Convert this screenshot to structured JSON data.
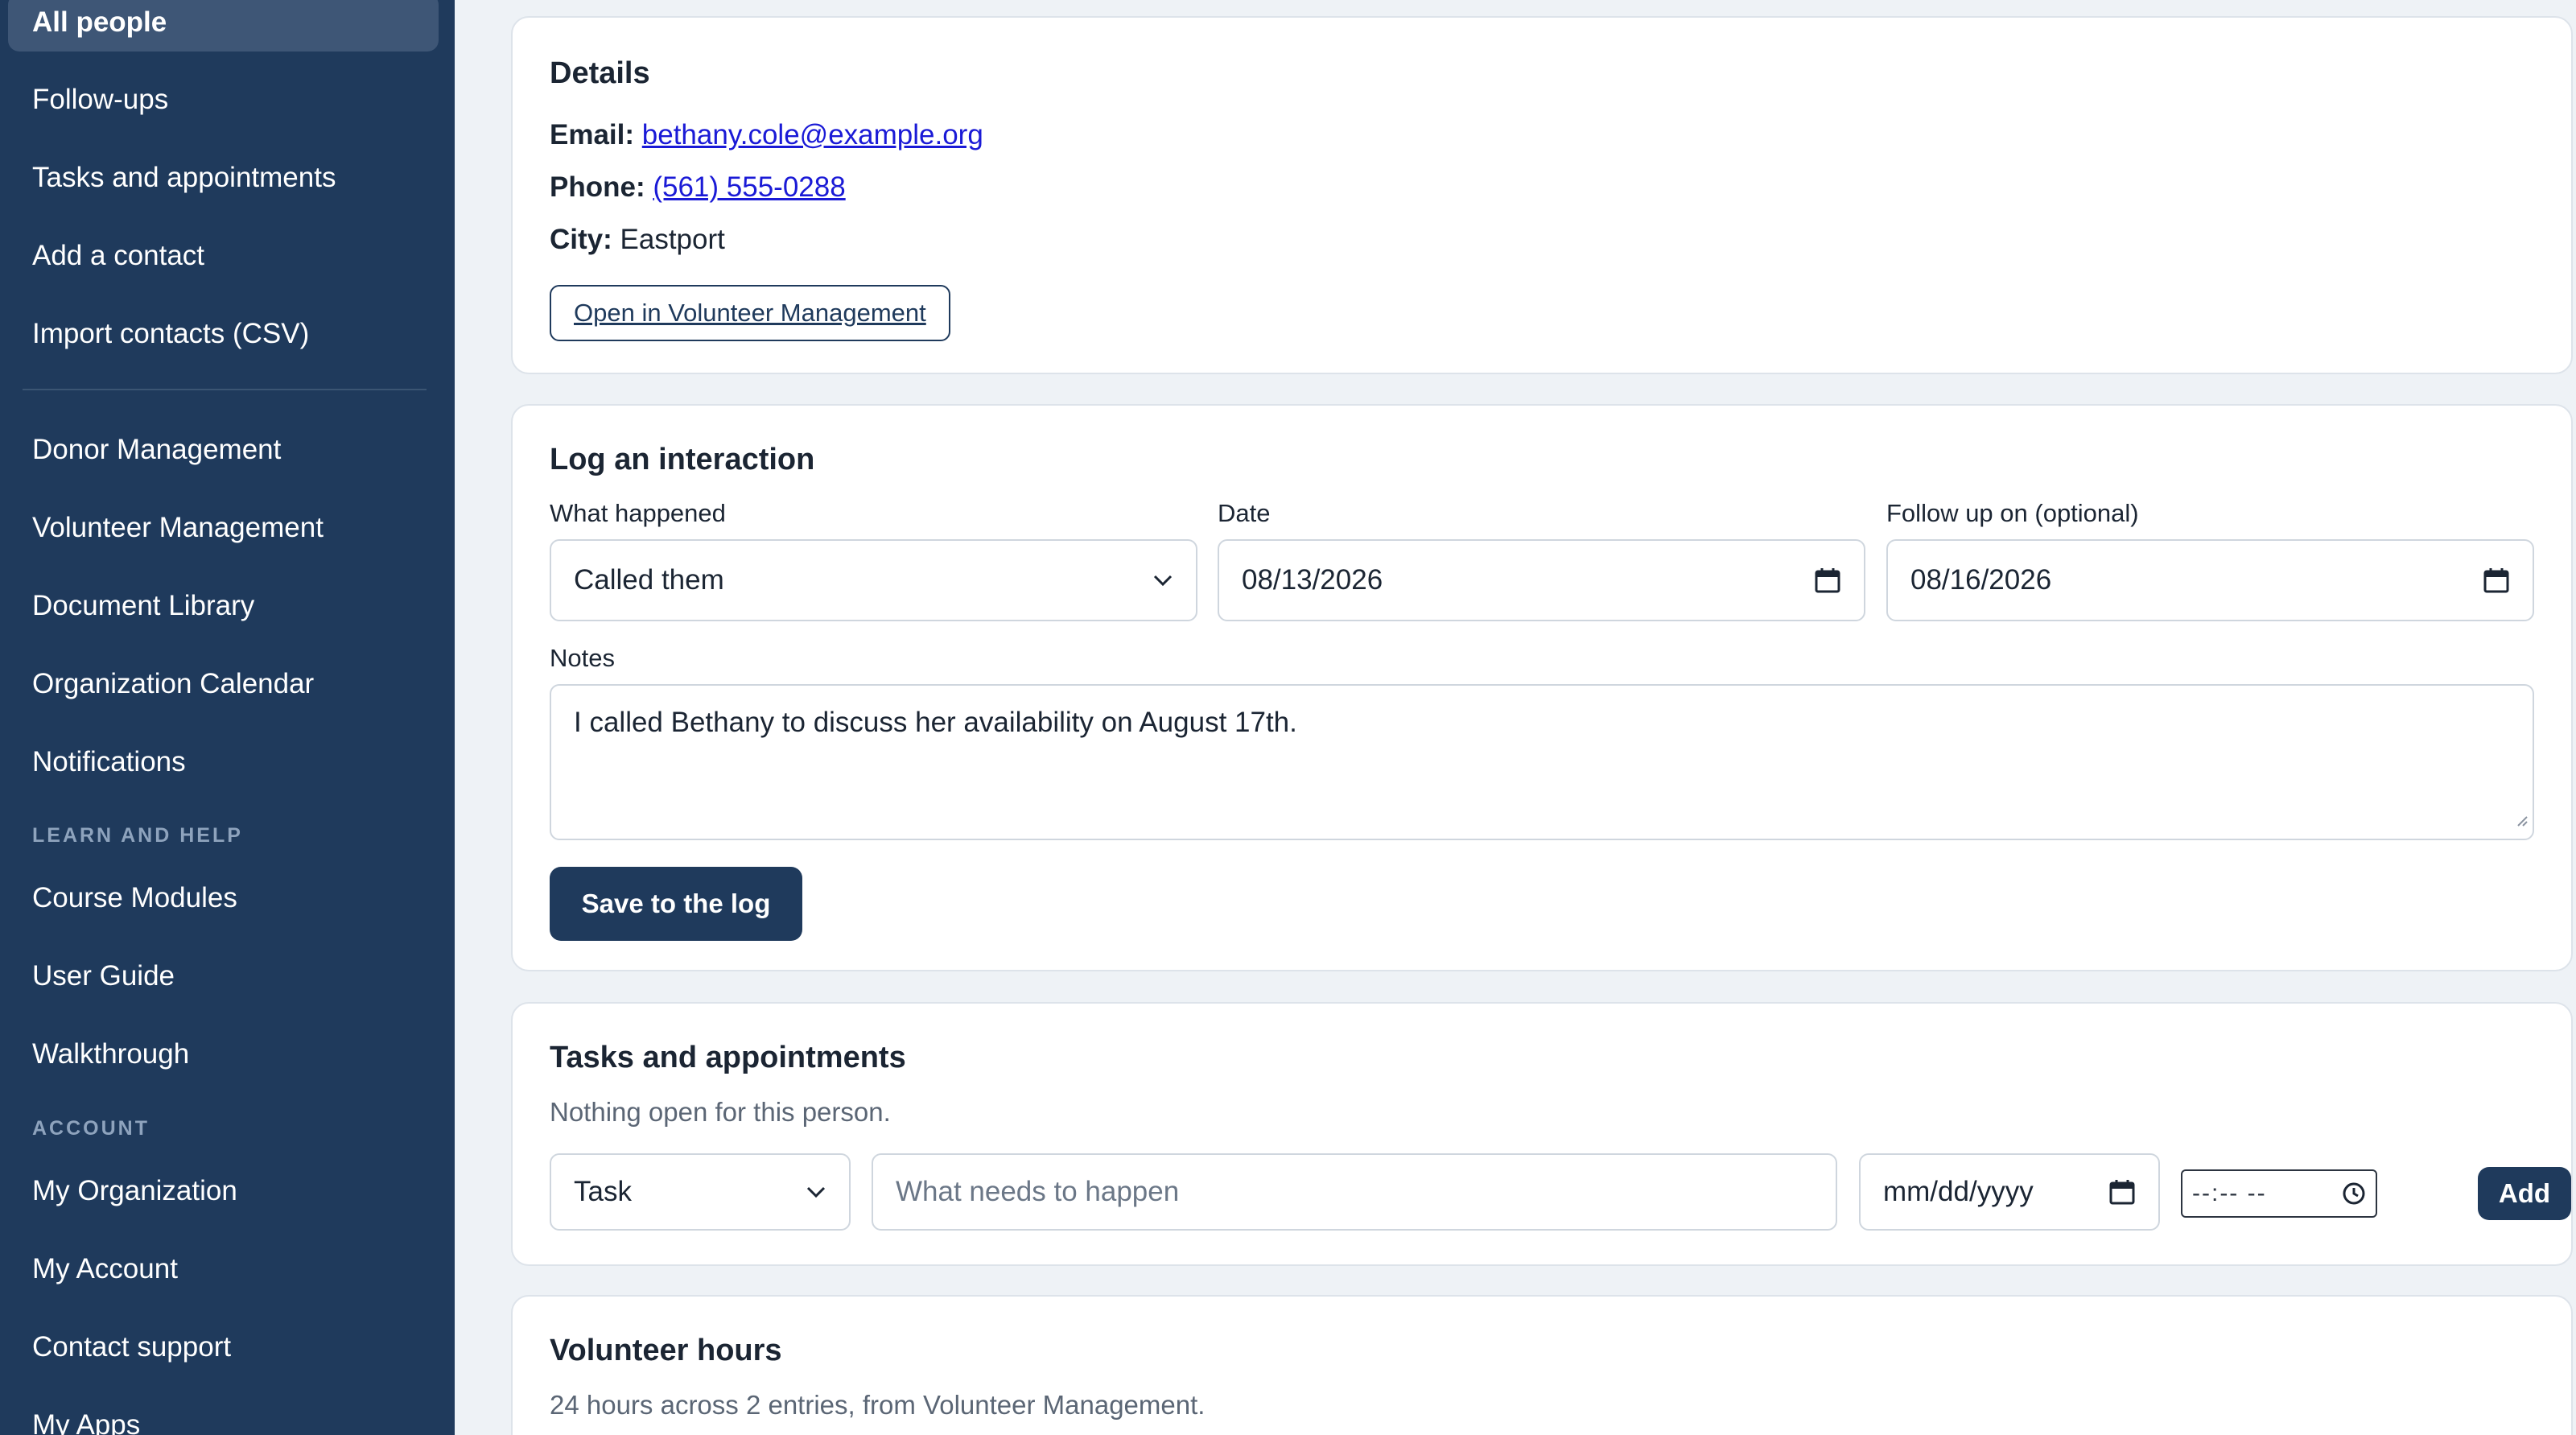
{
  "sidebar": {
    "items": [
      {
        "label": "All people",
        "active": true
      },
      {
        "label": "Follow-ups"
      },
      {
        "label": "Tasks and appointments"
      },
      {
        "label": "Add a contact"
      },
      {
        "label": "Import contacts (CSV)"
      },
      {
        "label": "Donor Management"
      },
      {
        "label": "Volunteer Management"
      },
      {
        "label": "Document Library"
      },
      {
        "label": "Organization Calendar"
      },
      {
        "label": "Notifications"
      },
      {
        "label": "Course Modules"
      },
      {
        "label": "User Guide"
      },
      {
        "label": "Walkthrough"
      },
      {
        "label": "My Organization"
      },
      {
        "label": "My Account"
      },
      {
        "label": "Contact support"
      },
      {
        "label": "My Apps"
      }
    ],
    "sections": {
      "learn": "LEARN AND HELP",
      "account": "ACCOUNT"
    }
  },
  "details": {
    "title": "Details",
    "email_label": "Email:",
    "email": "bethany.cole@example.org",
    "phone_label": "Phone:",
    "phone": "(561) 555-0288",
    "city_label": "City:",
    "city": "Eastport",
    "open_button": "Open in Volunteer Management"
  },
  "log": {
    "title": "Log an interaction",
    "what_label": "What happened",
    "what_value": "Called them",
    "date_label": "Date",
    "date_value": "08/13/2026",
    "followup_label": "Follow up on (optional)",
    "followup_value": "08/16/2026",
    "notes_label": "Notes",
    "notes_value": "I called Bethany to discuss her availability on August 17th.",
    "save_button": "Save to the log"
  },
  "tasks": {
    "title": "Tasks and appointments",
    "empty_text": "Nothing open for this person.",
    "type_value": "Task",
    "what_placeholder": "What needs to happen",
    "date_placeholder": "mm/dd/yyyy",
    "time_placeholder": "--:-- --",
    "add_button": "Add"
  },
  "hours": {
    "title": "Volunteer hours",
    "summary": "24 hours across 2 entries, from Volunteer Management."
  },
  "colors": {
    "sidebar_bg": "#1f3a5c",
    "sidebar_active": "#3e5676",
    "primary": "#1f3a5c",
    "link": "#1a1ad6",
    "page_bg": "#eef2f6"
  }
}
